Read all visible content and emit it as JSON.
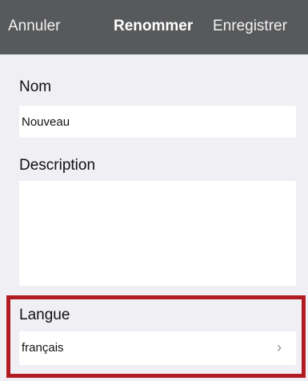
{
  "navbar": {
    "cancel_label": "Annuler",
    "title": "Renommer",
    "save_label": "Enregistrer"
  },
  "form": {
    "name_label": "Nom",
    "name_value": "Nouveau",
    "description_label": "Description",
    "description_value": "",
    "language_label": "Langue",
    "language_value": "français"
  },
  "icons": {
    "language_chevron": "chevron-right-icon"
  },
  "colors": {
    "navbar_bg": "#58595b",
    "highlight_border": "#b01c22",
    "page_bg": "#efeff4"
  }
}
